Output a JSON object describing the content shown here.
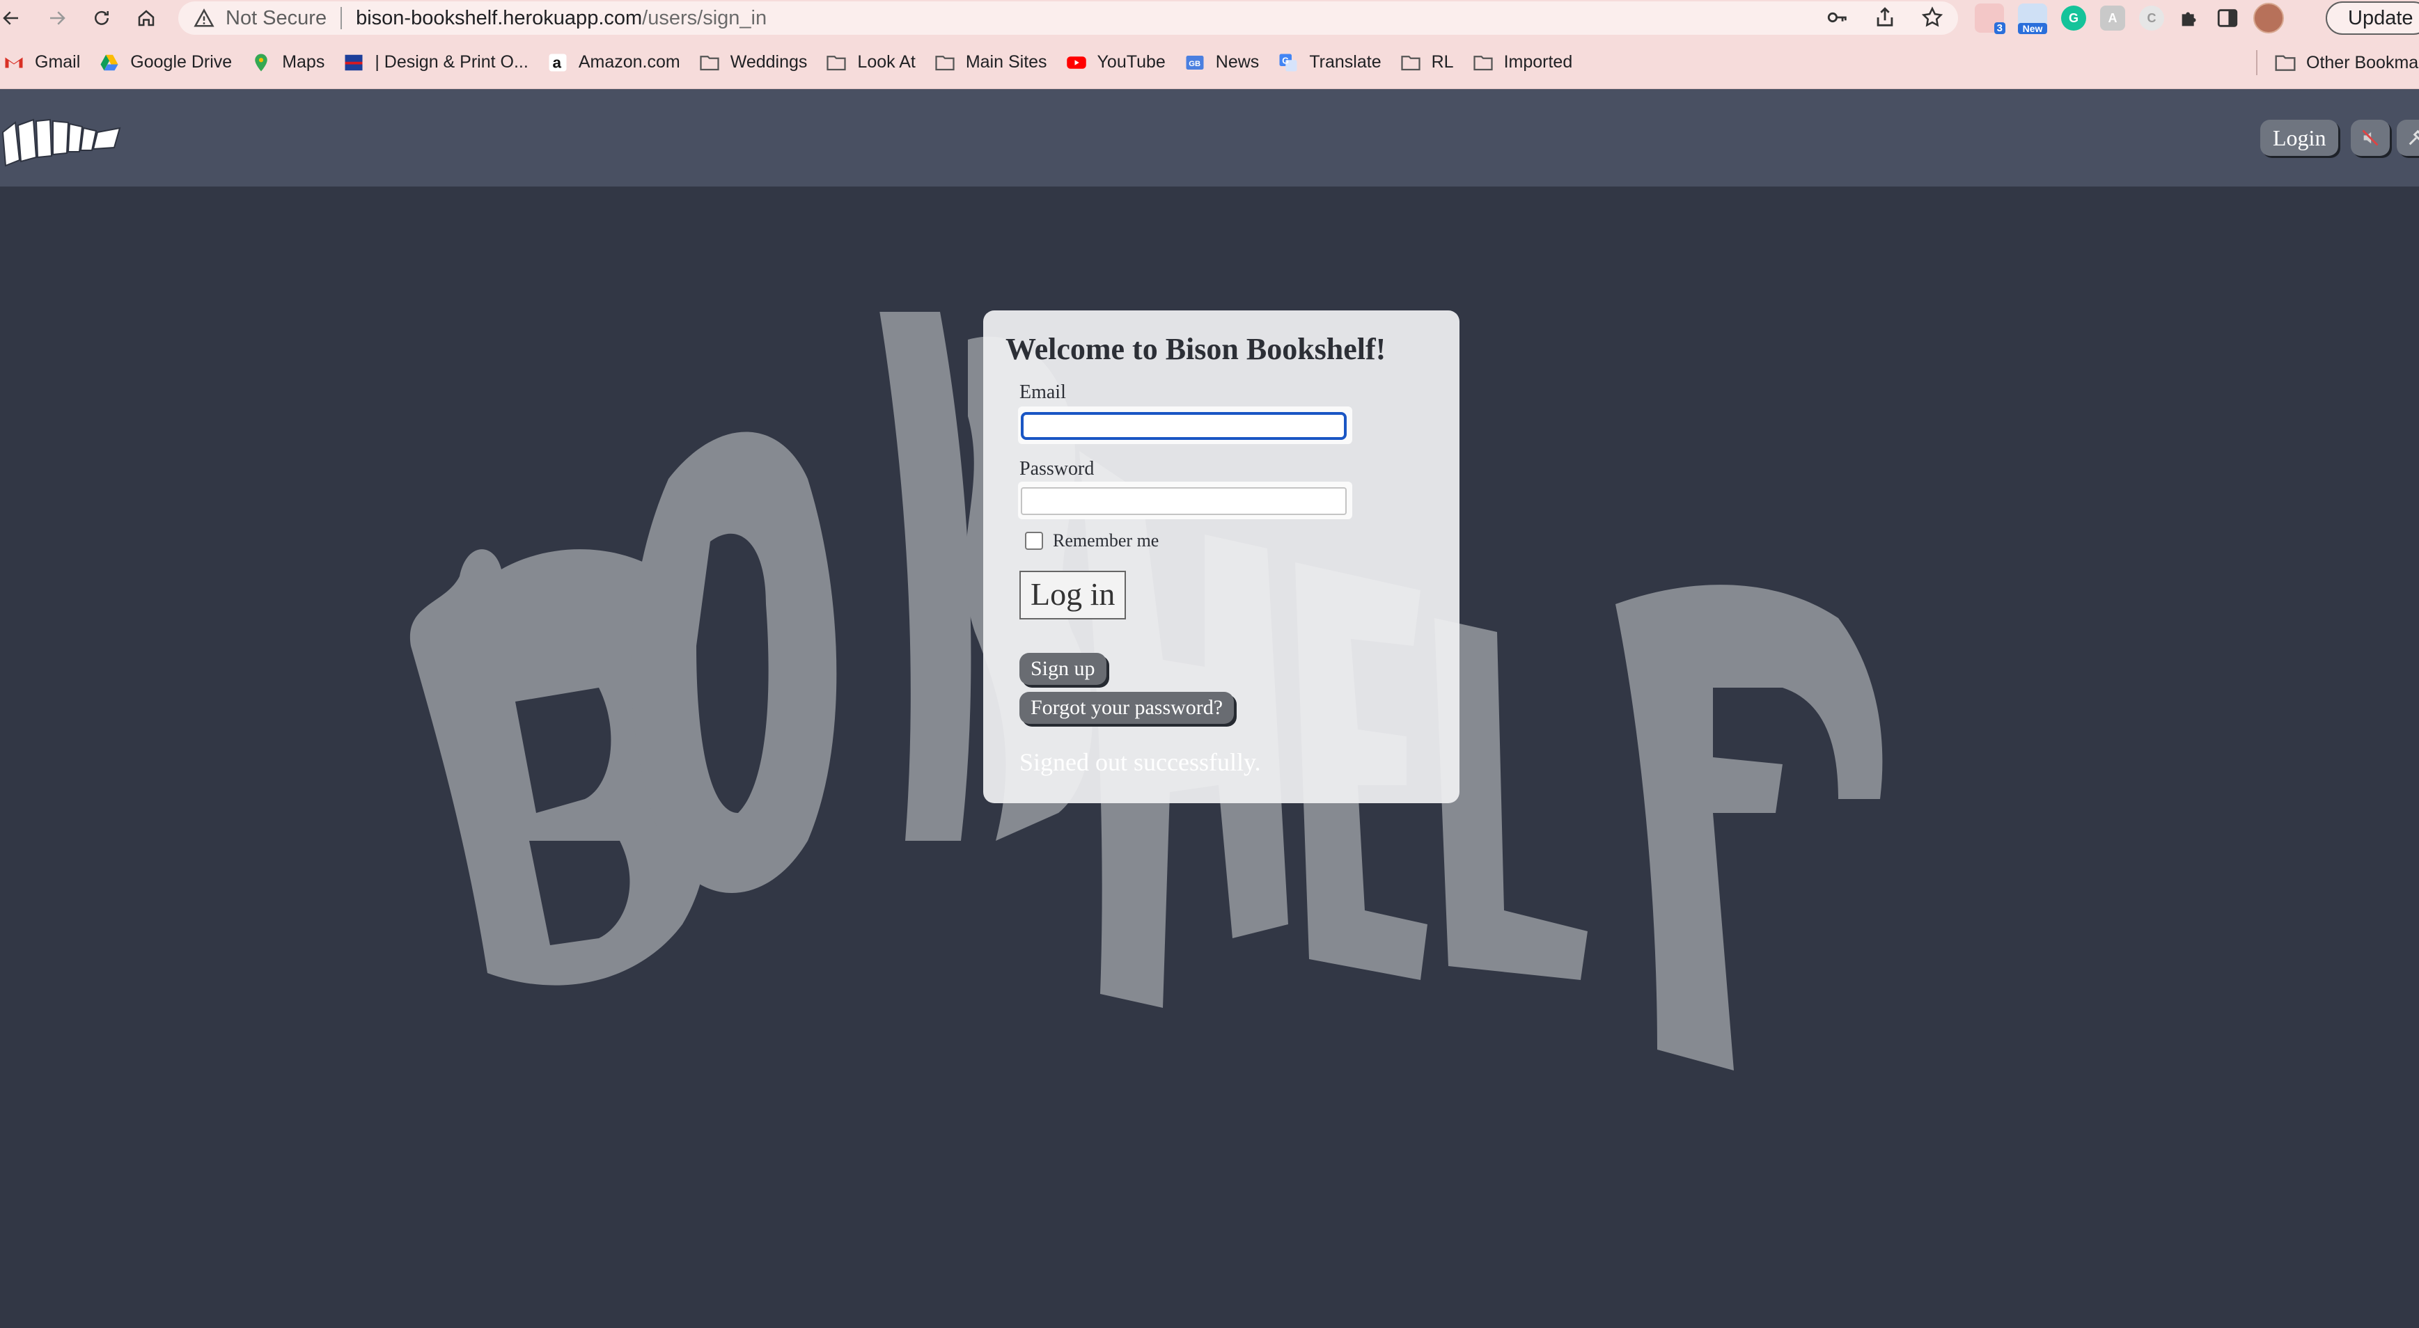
{
  "browser": {
    "security_label": "Not Secure",
    "url_host": "bison-bookshelf.herokuapp.com",
    "url_path": "/users/sign_in",
    "update_label": "Update",
    "extensions": [
      {
        "name": "badge-extension",
        "badge": "3"
      },
      {
        "name": "new-extension",
        "badge": "New"
      },
      {
        "name": "grammarly-extension",
        "badge": ""
      },
      {
        "name": "gray-extension",
        "badge": ""
      },
      {
        "name": "refresh-extension",
        "badge": ""
      }
    ]
  },
  "bookmarks": {
    "items": [
      {
        "label": "Gmail",
        "icon": "gmail-icon"
      },
      {
        "label": "Google Drive",
        "icon": "google-drive-icon"
      },
      {
        "label": "Maps",
        "icon": "maps-icon"
      },
      {
        "label": "| Design & Print O...",
        "icon": "avery-icon"
      },
      {
        "label": "Amazon.com",
        "icon": "amazon-icon"
      },
      {
        "label": "Weddings",
        "icon": "folder-icon"
      },
      {
        "label": "Look At",
        "icon": "folder-icon"
      },
      {
        "label": "Main Sites",
        "icon": "folder-icon"
      },
      {
        "label": "YouTube",
        "icon": "youtube-icon"
      },
      {
        "label": "News",
        "icon": "news-icon"
      },
      {
        "label": "Translate",
        "icon": "translate-icon"
      },
      {
        "label": "RL",
        "icon": "folder-icon"
      },
      {
        "label": "Imported",
        "icon": "folder-icon"
      }
    ],
    "other_label": "Other Bookma"
  },
  "header": {
    "login_label": "Login"
  },
  "form": {
    "title": "Welcome to Bison Bookshelf!",
    "email_label": "Email",
    "email_value": "",
    "password_label": "Password",
    "password_value": "",
    "remember_label": "Remember me",
    "remember_checked": false,
    "submit_label": "Log in",
    "signup_label": "Sign up",
    "forgot_label": "Forgot your password?",
    "flash_message": "Signed out successfully."
  },
  "colors": {
    "chrome_bg": "#f6dcdb",
    "header_bg": "#495062",
    "page_bg": "#323745",
    "art_fill": "#868a91",
    "focus_ring": "#1a56c4"
  }
}
